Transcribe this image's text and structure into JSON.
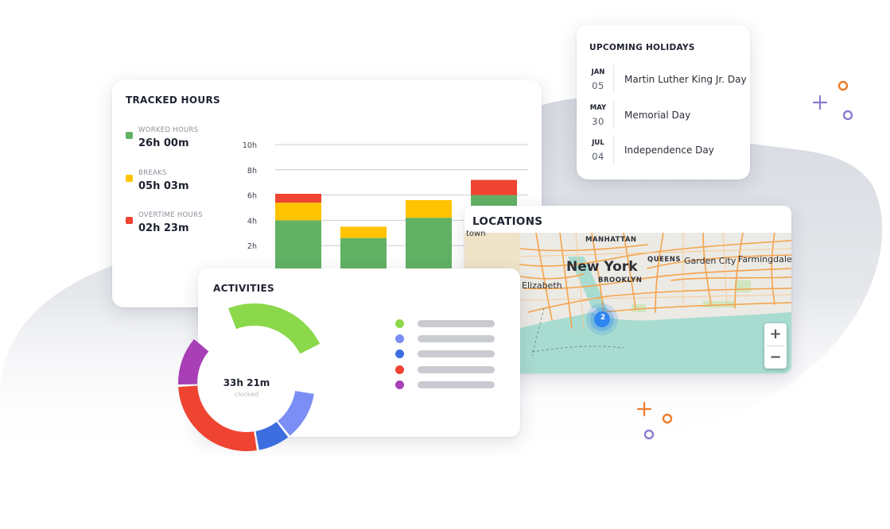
{
  "colors": {
    "worked": "#62b165",
    "breaks": "#ffc300",
    "overtime": "#ee4431",
    "deco_orange": "#f07c2c",
    "deco_purple": "#8a7bd1",
    "map_cluster": "#2f86f0"
  },
  "tracked_hours": {
    "title": "TRACKED HOURS",
    "legend": [
      {
        "label": "WORKED HOURS",
        "value": "26h 00m",
        "color": "#62b165"
      },
      {
        "label": "BREAKS",
        "value": "05h 03m",
        "color": "#ffc300"
      },
      {
        "label": "OVERTIME HOURS",
        "value": "02h 23m",
        "color": "#ee4431"
      }
    ]
  },
  "chart_data": {
    "type": "bar",
    "stacked": true,
    "categories": [
      "",
      "",
      "",
      ""
    ],
    "series": [
      {
        "name": "WORKED HOURS",
        "color": "#62b165",
        "values": [
          4.0,
          2.6,
          4.2,
          6.0
        ]
      },
      {
        "name": "BREAKS",
        "color": "#ffc300",
        "values": [
          1.4,
          0.9,
          1.4,
          0
        ]
      },
      {
        "name": "OVERTIME HOURS",
        "color": "#ee4431",
        "values": [
          0.7,
          0,
          0,
          1.2
        ]
      }
    ],
    "y_ticks": [
      "2h",
      "4h",
      "6h",
      "8h",
      "10h"
    ],
    "y_tick_values": [
      2,
      4,
      6,
      8,
      10
    ],
    "ylim": [
      0,
      10
    ],
    "grid": true
  },
  "holidays": {
    "title": "UPCOMING HOLIDAYS",
    "items": [
      {
        "month": "JAN",
        "day": "05",
        "name": "Martin Luther King Jr. Day"
      },
      {
        "month": "MAY",
        "day": "30",
        "name": "Memorial Day"
      },
      {
        "month": "JUL",
        "day": "04",
        "name": "Independence Day"
      }
    ]
  },
  "locations": {
    "title": "LOCATIONS",
    "map_labels": {
      "town": "town",
      "manhattan": "MANHATTAN",
      "new_york": "New York",
      "queens": "QUEENS",
      "garden_city": "Garden City",
      "farmingdale": "Farmingdale",
      "elizabeth": "Elizabeth",
      "brooklyn": "BROOKLYN"
    },
    "cluster_count": "2",
    "zoom_in": "+",
    "zoom_out": "−"
  },
  "activities": {
    "title": "ACTIVITIES",
    "total": "33h 21m",
    "total_label": "clocked",
    "segments": [
      {
        "color": "#8bd84b",
        "fraction": 0.24
      },
      {
        "color": "#7b8ef5",
        "fraction": 0.12
      },
      {
        "color": "#3d6ee0",
        "fraction": 0.08
      },
      {
        "color": "#ee4431",
        "fraction": 0.27
      },
      {
        "color": "#a83fb7",
        "fraction": 0.12
      }
    ],
    "legend_colors": [
      "#8bd84b",
      "#7b8ef5",
      "#3d6ee0",
      "#ee4431",
      "#a83fb7"
    ]
  }
}
